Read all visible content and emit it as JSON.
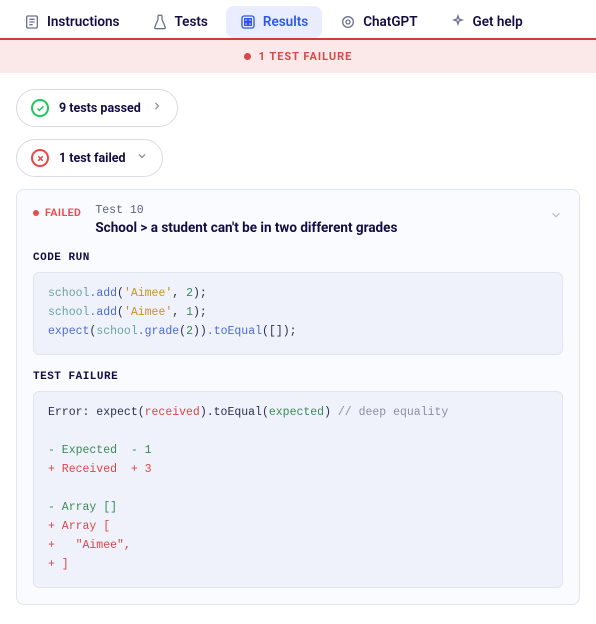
{
  "tabs": {
    "instructions": "Instructions",
    "tests": "Tests",
    "results": "Results",
    "chatgpt": "ChatGPT",
    "gethelp": "Get help"
  },
  "banner": {
    "text": "1 TEST FAILURE"
  },
  "summary": {
    "passed": "9 tests passed",
    "failed": "1 test failed"
  },
  "failure": {
    "tag": "FAILED",
    "test_num": "Test 10",
    "test_title": "School > a student can't be in two different grades",
    "code_run_label": "CODE RUN",
    "test_failure_label": "TEST FAILURE",
    "code": {
      "l1a": "school",
      "l1b": ".add",
      "l1c": "(",
      "l1d": "'Aimee'",
      "l1e": ", ",
      "l1f": "2",
      "l1g": ");",
      "l2a": "school",
      "l2b": ".add",
      "l2c": "(",
      "l2d": "'Aimee'",
      "l2e": ", ",
      "l2f": "1",
      "l2g": ");",
      "l3a": "expect",
      "l3b": "(",
      "l3c": "school",
      "l3d": ".grade",
      "l3e": "(",
      "l3f": "2",
      "l3g": "))",
      "l3h": ".toEqual",
      "l3i": "([]);"
    },
    "err": {
      "e1a": "Error: expect(",
      "e1b": "received",
      "e1c": ").toEqual(",
      "e1d": "expected",
      "e1e": ") ",
      "e1f": "// deep equality",
      "e2": "- Expected  - 1",
      "e3": "+ Received  + 3",
      "e4": "- Array []",
      "e5": "+ Array [",
      "e6": "+   \"Aimee\",",
      "e7": "+ ]"
    }
  }
}
